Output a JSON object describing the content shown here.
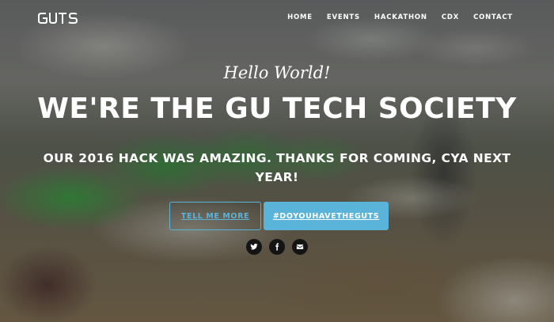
{
  "brand": {
    "logo_text": "GUTS"
  },
  "nav": {
    "items": [
      {
        "label": "HOME"
      },
      {
        "label": "EVENTS"
      },
      {
        "label": "HACKATHON"
      },
      {
        "label": "CDX"
      },
      {
        "label": "CONTACT"
      }
    ]
  },
  "hero": {
    "intro": "Hello World!",
    "heading": "WE'RE THE GU TECH SOCIETY",
    "subheading": "OUR 2016 HACK WAS AMAZING. THANKS FOR COMING, CYA NEXT YEAR!",
    "buttons": {
      "tell_more": "TELL ME MORE",
      "hashtag": "#DOYOUHAVETHEGUTS"
    }
  },
  "social": {
    "icons": [
      "twitter-icon",
      "facebook-icon",
      "envelope-icon"
    ]
  },
  "colors": {
    "accent": "#5ab3d9",
    "icon_bg": "#141414",
    "text": "#ffffff"
  }
}
